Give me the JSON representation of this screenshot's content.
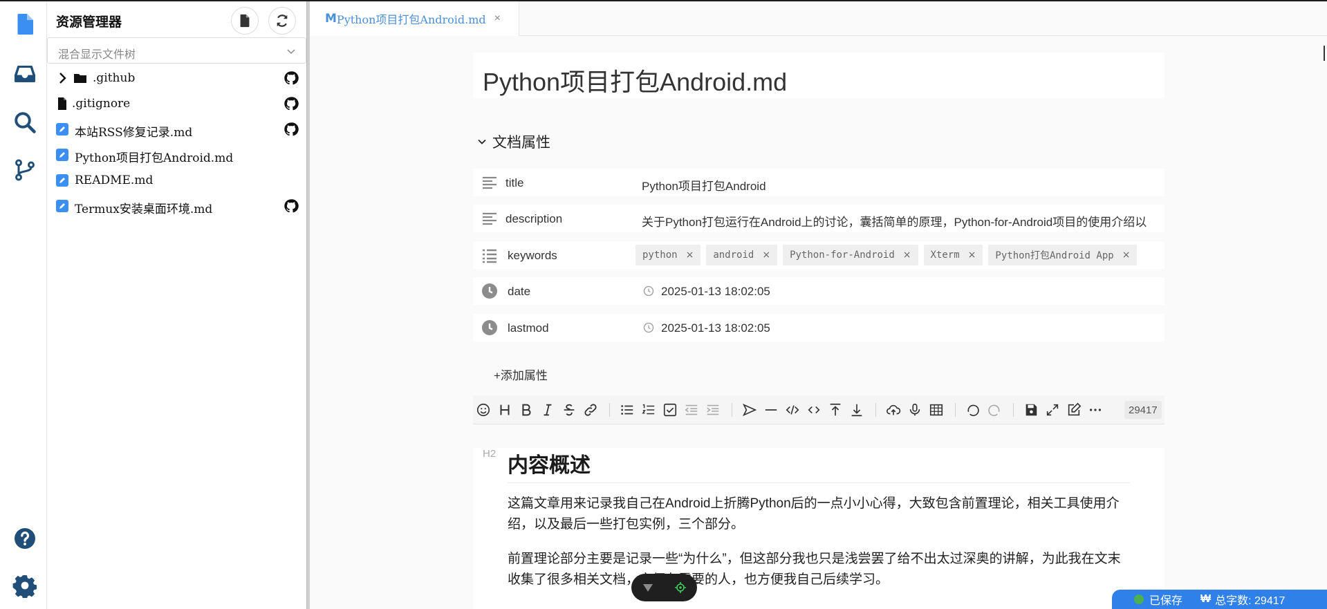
{
  "sidebar": {
    "title": "资源管理器",
    "filter_label": "混合显示文件树",
    "files": [
      {
        "name": ".github",
        "type": "folder",
        "git": true
      },
      {
        "name": ".gitignore",
        "type": "file",
        "git": true
      },
      {
        "name": "本站RSS修复记录.md",
        "type": "markdown",
        "git": true
      },
      {
        "name": "Python项目打包Android.md",
        "type": "markdown",
        "git": false
      },
      {
        "name": "README.md",
        "type": "markdown",
        "git": false
      },
      {
        "name": "Termux安装桌面环境.md",
        "type": "markdown",
        "git": true
      }
    ]
  },
  "tab": {
    "marker": "M",
    "title": "Python项目打包Android.md",
    "close": "×"
  },
  "document": {
    "title": "Python项目打包Android.md",
    "properties_label": "文档属性",
    "properties": {
      "title": {
        "key": "title",
        "value": "Python项目打包Android"
      },
      "description": {
        "key": "description",
        "value": "关于Python打包运行在Android上的讨论，囊括简单的原理，Python-for-Android项目的使用介绍以"
      },
      "keywords": {
        "key": "keywords",
        "tags": [
          "python",
          "android",
          "Python-for-Android",
          "Xterm",
          "Python打包Android App"
        ]
      },
      "date": {
        "key": "date",
        "value": "2025-01-13 18:02:05"
      },
      "lastmod": {
        "key": "lastmod",
        "value": "2025-01-13 18:02:05"
      }
    },
    "add_property": "+添加属性",
    "tag_close": "×"
  },
  "toolbar": {
    "char_count": "29417"
  },
  "content": {
    "h2_marker": "H2",
    "heading": "内容概述",
    "para1": "这篇文章用来记录我自己在Android上折腾Python后的一点小小心得，大致包含前置理论，相关工具使用介绍，以及最后一些打包实例，三个部分。",
    "para2": "前置理论部分主要是记录一些“为什么”，但这部分我也只是浅尝罢了给不出太过深奥的讲解，为此我在文末收集了很多相关文档，方便有需要的人，也方便我自己后续学习。"
  },
  "status": {
    "saved": "已保存",
    "wordcount_icon": "₩",
    "wordcount": "总字数: 29417"
  },
  "colors": {
    "accent": "#2f80e8",
    "icon_blue": "#3b8ff3",
    "activity_icon": "#1f4e79"
  }
}
